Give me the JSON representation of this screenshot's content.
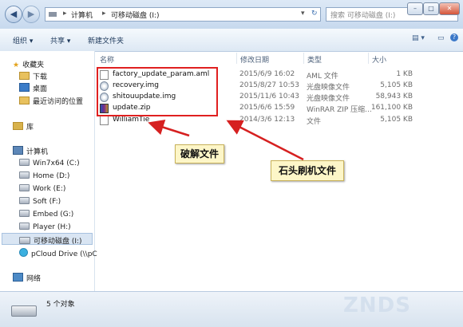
{
  "window": {
    "address": {
      "path_1": "计算机",
      "path_2": "可移动磁盘 (I:)",
      "separator": "▸"
    },
    "search_placeholder": "搜索 可移动磁盘 (I:)"
  },
  "toolbar": {
    "organize": "组织 ▾",
    "share": "共享 ▾",
    "new_folder": "新建文件夹"
  },
  "nav": {
    "favorites": "收藏夹",
    "downloads": "下载",
    "desktop": "桌面",
    "recent": "最近访问的位置",
    "libraries": "库",
    "computer": "计算机",
    "drives": [
      "Win7x64 (C:)",
      "Home (D:)",
      "Work (E:)",
      "Soft (F:)",
      "Embed (G:)",
      "Player (H:)",
      "可移动磁盘 (I:)",
      "pCloud Drive (\\\\pC"
    ],
    "network": "网络"
  },
  "columns": {
    "name": "名称",
    "date": "修改日期",
    "type": "类型",
    "size": "大小"
  },
  "files": [
    {
      "name": "factory_update_param.aml",
      "date": "2015/6/9 16:02",
      "type": "AML 文件",
      "size": "1 KB"
    },
    {
      "name": "recovery.img",
      "date": "2015/8/27 10:53",
      "type": "光盘映像文件",
      "size": "5,105 KB"
    },
    {
      "name": "shitouupdate.img",
      "date": "2015/11/6 10:43",
      "type": "光盘映像文件",
      "size": "58,943 KB"
    },
    {
      "name": "update.zip",
      "date": "2015/6/6 15:59",
      "type": "WinRAR ZIP 压缩...",
      "size": "161,100 KB"
    },
    {
      "name": "WilliamTie",
      "date": "2014/3/6 12:13",
      "type": "文件",
      "size": "5,105 KB"
    }
  ],
  "annotations": {
    "crack_file": "破解文件",
    "shitou_flash_files": "石头刷机文件"
  },
  "status": {
    "object_count": "5 个对象"
  },
  "watermark": "ZNDS",
  "icons": [
    "back-icon",
    "forward-icon",
    "drive-icon",
    "folder-icon",
    "star-icon",
    "network-icon",
    "search-icon"
  ]
}
